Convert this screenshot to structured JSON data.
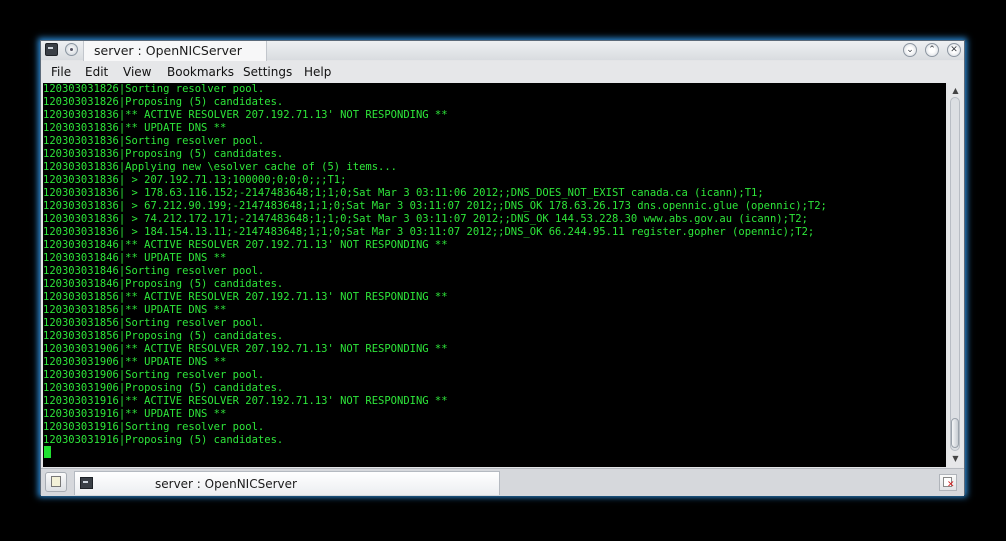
{
  "window": {
    "title": "server : OpenNICServer"
  },
  "menubar": {
    "items": [
      "File",
      "Edit",
      "View",
      "Bookmarks",
      "Settings",
      "Help"
    ]
  },
  "terminal": {
    "lines": [
      "120303031826|Sorting resolver pool.",
      "120303031826|Proposing (5) candidates.",
      "120303031836|** ACTIVE RESOLVER 207.192.71.13' NOT RESPONDING **",
      "120303031836|** UPDATE DNS **",
      "120303031836|Sorting resolver pool.",
      "120303031836|Proposing (5) candidates.",
      "120303031836|Applying new \\esolver cache of (5) items...",
      "120303031836| > 207.192.71.13;100000;0;0;0;;;T1;",
      "120303031836| > 178.63.116.152;-2147483648;1;1;0;Sat Mar 3 03:11:06 2012;;DNS_DOES_NOT_EXIST canada.ca (icann);T1;",
      "120303031836| > 67.212.90.199;-2147483648;1;1;0;Sat Mar 3 03:11:07 2012;;DNS_OK 178.63.26.173 dns.opennic.glue (opennic);T2;",
      "120303031836| > 74.212.172.171;-2147483648;1;1;0;Sat Mar 3 03:11:07 2012;;DNS_OK 144.53.228.30 www.abs.gov.au (icann);T2;",
      "120303031836| > 184.154.13.11;-2147483648;1;1;0;Sat Mar 3 03:11:07 2012;;DNS_OK 66.244.95.11 register.gopher (opennic);T2;",
      "120303031846|** ACTIVE RESOLVER 207.192.71.13' NOT RESPONDING **",
      "120303031846|** UPDATE DNS **",
      "120303031846|Sorting resolver pool.",
      "120303031846|Proposing (5) candidates.",
      "120303031856|** ACTIVE RESOLVER 207.192.71.13' NOT RESPONDING **",
      "120303031856|** UPDATE DNS **",
      "120303031856|Sorting resolver pool.",
      "120303031856|Proposing (5) candidates.",
      "120303031906|** ACTIVE RESOLVER 207.192.71.13' NOT RESPONDING **",
      "120303031906|** UPDATE DNS **",
      "120303031906|Sorting resolver pool.",
      "120303031906|Proposing (5) candidates.",
      "120303031916|** ACTIVE RESOLVER 207.192.71.13' NOT RESPONDING **",
      "120303031916|** UPDATE DNS **",
      "120303031916|Sorting resolver pool.",
      "120303031916|Proposing (5) candidates."
    ]
  },
  "tabbar": {
    "session_label": "server : OpenNICServer"
  },
  "colors": {
    "terminal_text": "#2ee63a",
    "terminal_bg": "#000000",
    "window_glow": "#2c8ad6"
  },
  "icons": {
    "window": "terminal-icon",
    "menu": "window-menu-icon",
    "minimize": "minimize-icon",
    "maximize": "maximize-icon",
    "close": "close-icon",
    "new_tab": "new-tab-icon",
    "close_tab": "close-tab-icon"
  }
}
